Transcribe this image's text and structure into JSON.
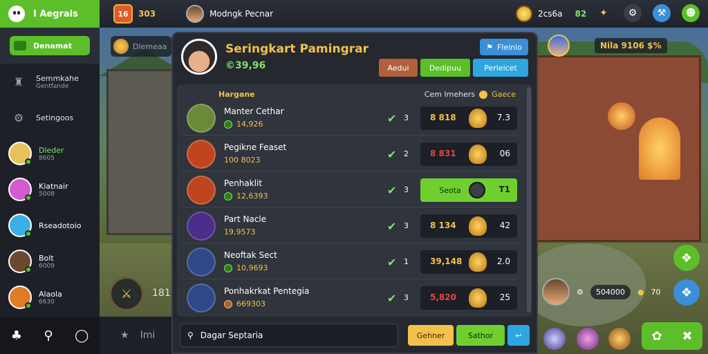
{
  "topbar": {
    "title": "I Aegrals",
    "level_badge": "16",
    "level_count": "303",
    "username": "Modngk Pecnar",
    "coin_count": "2cs6a",
    "gem_count": "82"
  },
  "sidebar": {
    "active": "Denamat",
    "items": [
      {
        "label": "Semmkahe",
        "sub": "Gentfande"
      },
      {
        "label": "Setingoos",
        "sub": ""
      }
    ],
    "friends": [
      {
        "name": "Dleder",
        "sub": "8605",
        "color": "#e6c35a"
      },
      {
        "name": "Kiatnair",
        "sub": "5008",
        "color": "#d45ad0"
      },
      {
        "name": "Rseadotoio",
        "sub": "",
        "color": "#3ab0e6"
      },
      {
        "name": "Bolt",
        "sub": "6009",
        "color": "#6a4a2e"
      },
      {
        "name": "Alaola",
        "sub": "6630",
        "color": "#e07b28"
      }
    ]
  },
  "left_scene": {
    "box_label": "Dlemeaa",
    "number": "181"
  },
  "lowbar_label": "Imi",
  "modal": {
    "title": "Seringkart Pamingrar",
    "subtitle": "©39,96",
    "top_button": "Fleinio",
    "tabs": [
      "Aedui",
      "Dedipuu",
      "Perleicet"
    ],
    "list_header": "Hargane",
    "col_left": "Cem Imehers",
    "col_right": "Gaece",
    "rows": [
      {
        "name": "Manter Cethar",
        "score": "14,926",
        "checks": "3",
        "value": "8 818",
        "num": "7.3",
        "avatar": "#6a8a3a"
      },
      {
        "name": "Pegikne Feaset",
        "score": "100 8023",
        "checks": "2",
        "value": "8 831",
        "num": "06",
        "avatar": "#c0451f"
      },
      {
        "name": "Penhaklit",
        "score": "12,6393",
        "checks": "3",
        "value": "Seota",
        "num": "T1",
        "avatar": "#c0451f",
        "highlight": true
      },
      {
        "name": "Part Nacle",
        "score": "19,9573",
        "checks": "3",
        "value": "8 134",
        "num": "42",
        "avatar": "#4a2e8a"
      },
      {
        "name": "Neoftak Sect",
        "score": "10,9693",
        "checks": "1",
        "value": "39,148",
        "num": "2.0",
        "avatar": "#2e4a8a"
      },
      {
        "name": "Ponhakrkat Pentegia",
        "score": "669303",
        "checks": "3",
        "value": "5,820",
        "num": "25",
        "avatar": "#2e4a8a"
      }
    ],
    "search_placeholder": "Dagar Septaria",
    "btn_a": "Gehner",
    "btn_b": "Sathor"
  },
  "right_scene": {
    "player_label": "Nila 9106 $%",
    "bottom_value": "504000",
    "bottom_coins": "70"
  },
  "colors": {
    "accent": "#5cbf2a",
    "gold": "#f3c14b",
    "blue": "#3a8fd8"
  }
}
